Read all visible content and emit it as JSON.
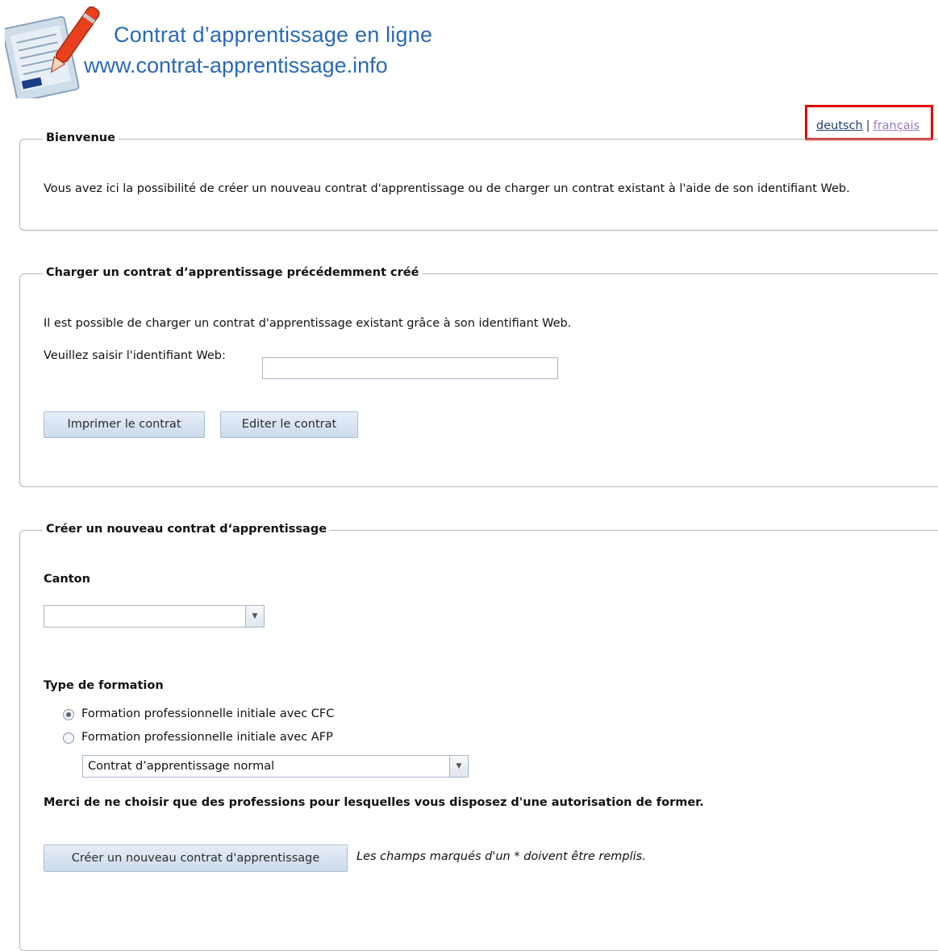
{
  "header": {
    "title": "Contrat d’apprentissage en ligne",
    "url": "www.contrat-apprentissage.info"
  },
  "language": {
    "deutsch": "deutsch",
    "separator": "|",
    "francais": "français"
  },
  "welcome": {
    "legend": "Bienvenue",
    "text": "Vous avez ici la possibilité de créer un nouveau contrat d'apprentissage ou de charger un contrat existant à l'aide de son identifiant Web."
  },
  "load": {
    "legend": "Charger un contrat d’apprentissage précédemment créé",
    "text": "Il est possible de charger un contrat d'apprentissage existant grâce à son identifiant Web.",
    "field_label": "Veuillez saisir l'identifiant Web:",
    "field_value": "",
    "print_button": "Imprimer le contrat",
    "edit_button": "Editer le contrat"
  },
  "create": {
    "legend": "Créer un nouveau contrat d‘apprentissage",
    "canton_label": "Canton",
    "canton_value": "",
    "training_label": "Type de formation",
    "options": [
      {
        "label": "Formation professionnelle initiale avec CFC",
        "selected": true
      },
      {
        "label": "Formation professionnelle initiale avec AFP",
        "selected": false
      }
    ],
    "contract_type_value": "Contrat d’apprentissage normal",
    "notice": "Merci de ne choisir que des professions pour lesquelles vous disposez d'une autorisation de former.",
    "create_button": "Créer un nouveau contrat d'apprentissage",
    "required_note": "Les champs marqués d'un * doivent être remplis."
  },
  "colors": {
    "brand": "#2a69b4",
    "highlight_box": "#e00000",
    "link_visited": "#9b79c8"
  }
}
